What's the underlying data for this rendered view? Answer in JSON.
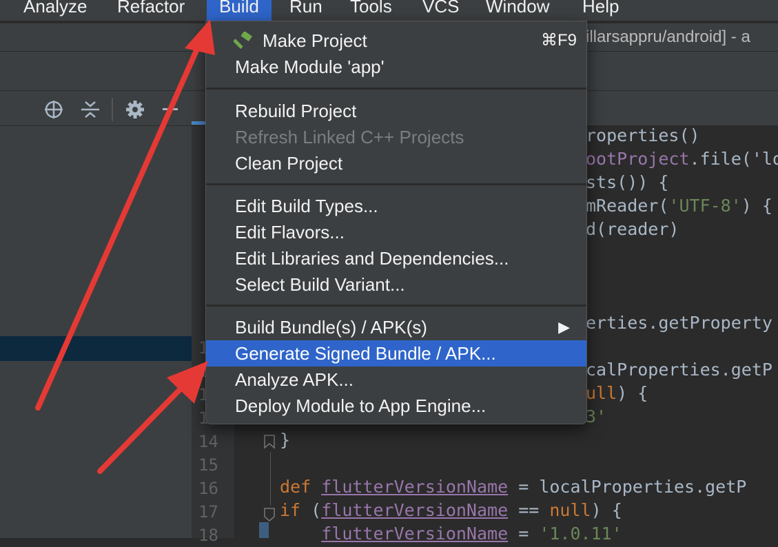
{
  "menubar": {
    "items": [
      "Analyze",
      "Refactor",
      "Build",
      "Run",
      "Tools",
      "VCS",
      "Window",
      "Help"
    ],
    "active": "Build"
  },
  "window": {
    "title_fragment": "illarsappru/android] - a"
  },
  "project_toolbar": {
    "icons": [
      "locate-icon",
      "collapse-icon",
      "gear-icon",
      "hide-icon"
    ]
  },
  "build_menu": {
    "make_project": "Make Project",
    "make_project_shortcut": "⌘F9",
    "make_module": "Make Module 'app'",
    "rebuild_project": "Rebuild Project",
    "refresh_cpp": "Refresh Linked C++ Projects",
    "clean_project": "Clean Project",
    "edit_build_types": "Edit Build Types...",
    "edit_flavors": "Edit Flavors...",
    "edit_libraries": "Edit Libraries and Dependencies...",
    "select_variant": "Select Build Variant...",
    "build_bundle": "Build Bundle(s) / APK(s)",
    "submenu_arrow": "▶",
    "generate_signed": "Generate Signed Bundle / APK...",
    "analyze_apk": "Analyze APK...",
    "deploy_module": "Deploy Module to App Engine..."
  },
  "editor": {
    "line_numbers": [
      "1",
      "1",
      "1",
      "1",
      "14",
      "15",
      "16",
      "17",
      "18"
    ],
    "code": {
      "l1": "roperties()",
      "l2a": "ootProject",
      "l2b": ".file('lo",
      "l3": "sts()) {",
      "l4a": "mReader(",
      "l4b": "'UTF-8'",
      "l4c": ") {",
      "l5": "d(reader)",
      "l8": "erties.getProperty",
      "l10": "calProperties.getP",
      "l11a": "ull",
      "l11b": ") {",
      "l12": "3'",
      "l14": "}",
      "l16_kw": "def ",
      "l16_var": "flutterVersionName",
      "l16_rest": " = localProperties.getP",
      "l17_kw": "if ",
      "l17_p": "(",
      "l17_var": "flutterVersionName",
      "l17_rest": " == ",
      "l17_null": "null",
      "l17_end": ") {",
      "l18_var": "flutterVersionName",
      "l18_rest": " = ",
      "l18_str": "'1.0.11'"
    }
  },
  "colors": {
    "accent": "#2f65ca",
    "annotation_arrow": "#e53935"
  }
}
